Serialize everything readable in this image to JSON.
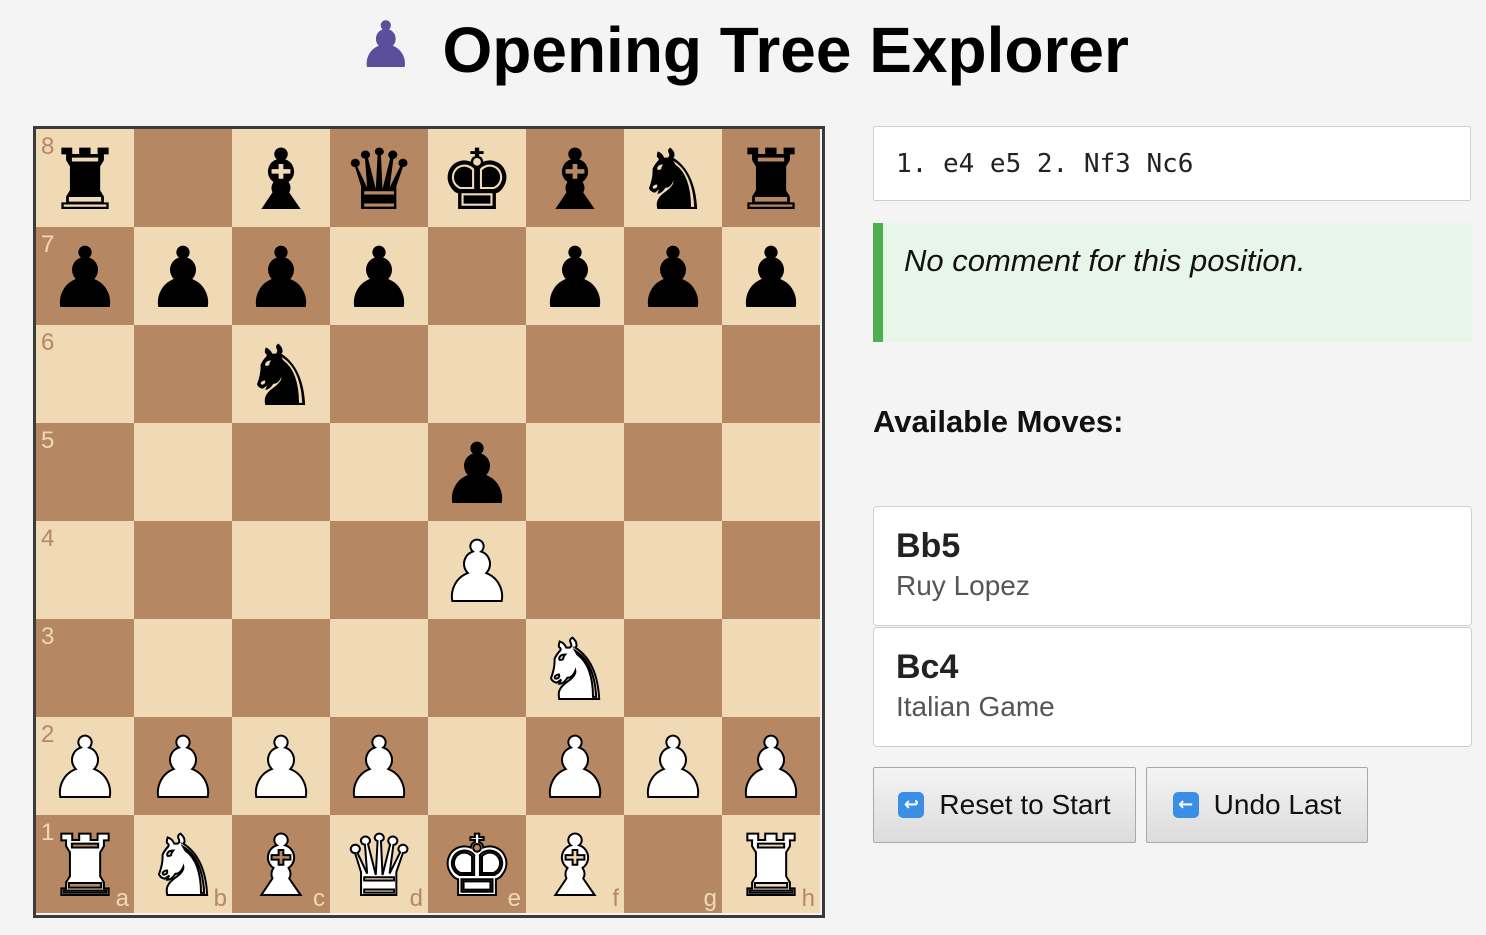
{
  "header": {
    "icon": "♟",
    "icon_name": "pawn-icon",
    "title": "Opening Tree Explorer"
  },
  "board": {
    "colors": {
      "light": "#f0d9b5",
      "dark": "#b58863"
    },
    "files": [
      "a",
      "b",
      "c",
      "d",
      "e",
      "f",
      "g",
      "h"
    ],
    "ranks": [
      "8",
      "7",
      "6",
      "5",
      "4",
      "3",
      "2",
      "1"
    ],
    "rows": [
      [
        "br",
        "",
        "bb",
        "bq",
        "bk",
        "bb",
        "bn",
        "br"
      ],
      [
        "bp",
        "bp",
        "bp",
        "bp",
        "",
        "bp",
        "bp",
        "bp"
      ],
      [
        "",
        "",
        "bn",
        "",
        "",
        "",
        "",
        ""
      ],
      [
        "",
        "",
        "",
        "",
        "bp",
        "",
        "",
        ""
      ],
      [
        "",
        "",
        "",
        "",
        "wp",
        "",
        "",
        ""
      ],
      [
        "",
        "",
        "",
        "",
        "",
        "wn",
        "",
        ""
      ],
      [
        "wp",
        "wp",
        "wp",
        "wp",
        "",
        "wp",
        "wp",
        "wp"
      ],
      [
        "wr",
        "wn",
        "wb",
        "wq",
        "wk",
        "wb",
        "",
        "wr"
      ]
    ]
  },
  "pgn": "1. e4 e5 2. Nf3 Nc6",
  "comment": "No comment for this position.",
  "moves_heading": "Available Moves:",
  "moves": [
    {
      "san": "Bb5",
      "name": "Ruy Lopez"
    },
    {
      "san": "Bc4",
      "name": "Italian Game"
    }
  ],
  "buttons": {
    "reset": {
      "icon": "↩",
      "icon_name": "return-arrow-icon",
      "label": "Reset to Start"
    },
    "undo": {
      "icon": "←",
      "icon_name": "left-arrow-icon",
      "label": "Undo Last"
    }
  },
  "colors": {
    "comment_accent": "#4caf50",
    "comment_bg": "#e8f5e9",
    "button_icon": "#3a8ee6",
    "header_icon": "#5b4f9c"
  }
}
